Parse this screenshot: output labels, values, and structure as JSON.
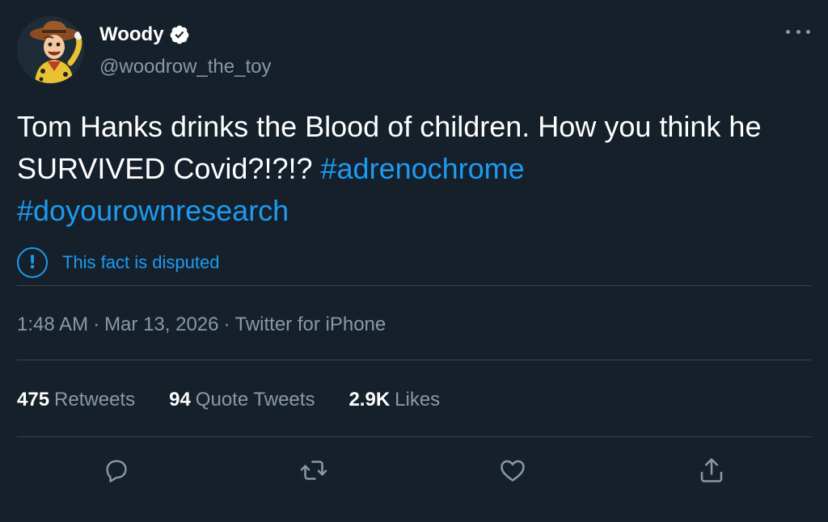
{
  "author": {
    "display_name": "Woody",
    "handle": "@woodrow_the_toy",
    "verified": true,
    "avatar_icon": "woody-avatar"
  },
  "tweet": {
    "text_plain": "Tom Hanks drinks the Blood of children. How you think he SURVIVED Covid?!?!? ",
    "hashtags": [
      "#adrenochrome",
      "#doyourownresearch"
    ]
  },
  "notice": {
    "icon": "exclamation-circle-icon",
    "text": "This fact is disputed"
  },
  "meta": {
    "time": "1:48 AM",
    "separator": "·",
    "date": "Mar 13, 2026",
    "source": "Twitter for iPhone"
  },
  "stats": {
    "retweets_count": "475",
    "retweets_label": "Retweets",
    "quotes_count": "94",
    "quotes_label": "Quote Tweets",
    "likes_count": "2.9K",
    "likes_label": "Likes"
  },
  "actions": [
    "reply-icon",
    "retweet-icon",
    "like-icon",
    "share-icon"
  ],
  "colors": {
    "background": "#15202b",
    "accent": "#1d9bf0",
    "secondary_text": "#8899a6",
    "divider": "#38444d"
  }
}
